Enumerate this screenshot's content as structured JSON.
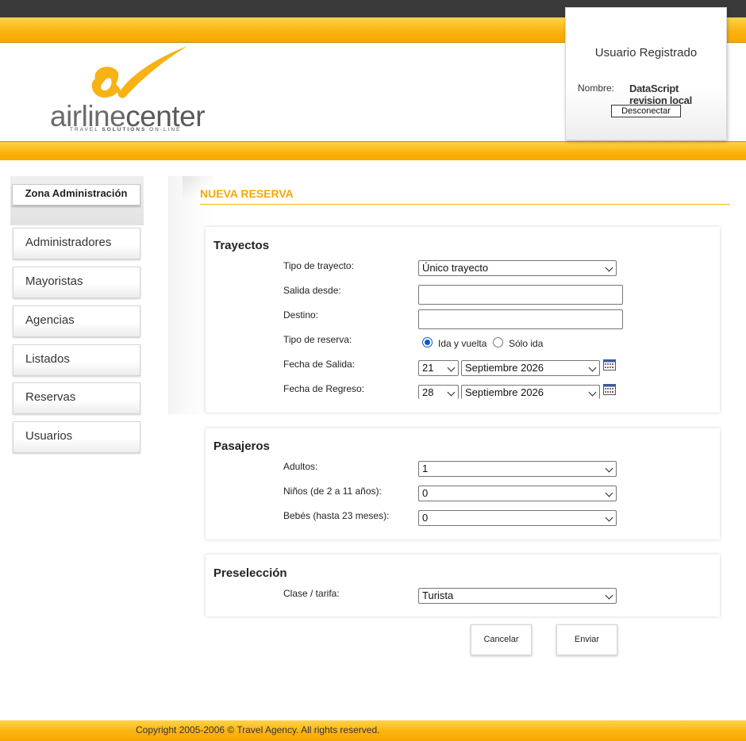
{
  "logo": {
    "text_light": "airline",
    "text_bold": "center",
    "tagline_pre": "TRAVEL ",
    "tagline_bold": "SOLUTIONS",
    "tagline_post": " ON-LINE"
  },
  "user_panel": {
    "title": "Usuario Registrado",
    "name_label": "Nombre:",
    "name_value": "DataScript revision local",
    "logout_label": "Desconectar"
  },
  "sidebar": {
    "heading": "Zona Administración",
    "items": [
      {
        "label": "Administradores"
      },
      {
        "label": "Mayoristas"
      },
      {
        "label": "Agencias"
      },
      {
        "label": "Listados"
      },
      {
        "label": "Reservas"
      },
      {
        "label": "Usuarios"
      }
    ]
  },
  "page": {
    "title": "NUEVA RESERVA"
  },
  "trayectos": {
    "title": "Trayectos",
    "tipo_trayecto_label": "Tipo de trayecto:",
    "tipo_trayecto_value": "Único trayecto",
    "salida_label": "Salida desde:",
    "salida_value": "",
    "destino_label": "Destino:",
    "destino_value": "",
    "tipo_reserva_label": "Tipo de reserva:",
    "radio_ida_vuelta": "Ida y vuelta",
    "radio_solo_ida": "Sólo ida",
    "selected_tipo_reserva": "Ida y vuelta",
    "fecha_salida_label": "Fecha de Salida:",
    "fecha_salida_day": "21",
    "fecha_salida_month": "Septiembre 2026",
    "fecha_regreso_label": "Fecha de Regreso:",
    "fecha_regreso_day": "28",
    "fecha_regreso_month": "Septiembre 2026",
    "calendar_icon": "calendar-icon"
  },
  "pasajeros": {
    "title": "Pasajeros",
    "adultos_label": "Adultos:",
    "adultos_value": "1",
    "ninos_label": "Niños (de 2 a 11 años):",
    "ninos_value": "0",
    "bebes_label": "Bebés (hasta 23 meses):",
    "bebes_value": "0"
  },
  "preseleccion": {
    "title": "Preselección",
    "clase_label": "Clase / tarifa:",
    "clase_value": "Turista"
  },
  "actions": {
    "cancel_label": "Cancelar",
    "submit_label": "Enviar"
  },
  "footer": {
    "copyright": "Copyright 2005-2006 © Travel Agency. All rights reserved."
  },
  "colors": {
    "accent": "#f4a800",
    "band": "#fbb411",
    "topbar": "#3a3a3a",
    "radio": "#0b57d0"
  }
}
